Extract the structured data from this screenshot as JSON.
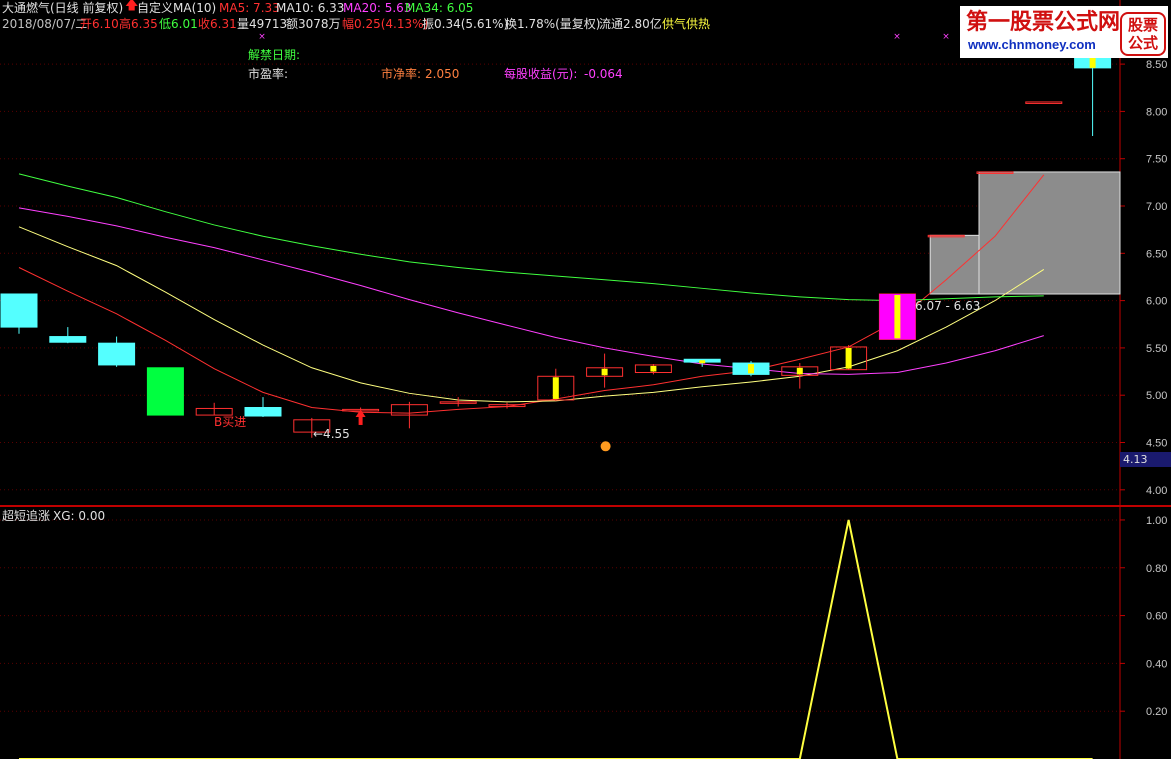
{
  "header": {
    "stock_name": "大通燃气",
    "period": "(日线 前复权)",
    "indicator_name": "自定义MA(10)",
    "ma5": "MA5: 7.33",
    "ma10": "MA10: 6.33",
    "ma20": "MA20: 5.63",
    "ma34": "MA34: 6.05",
    "date": "2018/08/07/二",
    "open_label": "开",
    "open": "6.10",
    "high_label": "高",
    "high": "6.35",
    "low_label": "低",
    "low": "6.01",
    "close_label": "收",
    "close": "6.31",
    "volume": "量49713",
    "amount": "额3078万",
    "change_label": "幅",
    "change": "0.25(4.13%)",
    "amplitude": "振0.34(5.61%)",
    "turnover": "换1.78%(量复权)",
    "float": "流通2.80亿",
    "concept": "供气供热"
  },
  "info": {
    "unlock_date": "解禁日期:",
    "pe": "市盈率:",
    "pb_label": "市净率:",
    "pb": "2.050",
    "eps_label": "每股收益(元):",
    "eps": "-0.064"
  },
  "annotations": {
    "buy_signal": "B买进",
    "low_marker": "←4.55",
    "range_label": "6.07 - 6.63",
    "current_price": "4.13"
  },
  "watermark": {
    "title": "第一股票公式网",
    "url": "www.chnmoney.com",
    "badge_top": "股票",
    "badge_bottom": "公式"
  },
  "sub_panel": {
    "name": "超短追涨",
    "xg": "XG: 0.00"
  },
  "colors": {
    "up": "#ff3030",
    "down_cyan": "#54ffff",
    "down_green": "#00ff40",
    "ma5": "#ff3030",
    "ma10": "#ffff80",
    "ma20": "#ff40ff",
    "ma34": "#40ff40",
    "axis": "#c00000",
    "grid": "#5a0000",
    "gray_box": "#8c8c8c"
  },
  "chart_data": [
    {
      "type": "candlestick",
      "title": "大通燃气(日线 前复权)",
      "ylim": [
        3.85,
        8.85
      ],
      "yticks": [
        "4.00",
        "4.50",
        "5.00",
        "5.50",
        "6.00",
        "6.50",
        "7.00",
        "7.50",
        "8.00",
        "8.50"
      ],
      "candles": [
        {
          "open": 6.07,
          "high": 6.07,
          "low": 5.65,
          "close": 5.72
        },
        {
          "open": 5.62,
          "high": 5.72,
          "low": 5.55,
          "close": 5.56
        },
        {
          "open": 5.55,
          "high": 5.62,
          "low": 5.3,
          "close": 5.32
        },
        {
          "open": 5.29,
          "high": 5.29,
          "low": 4.79,
          "close": 4.79
        },
        {
          "open": 4.79,
          "high": 4.92,
          "low": 4.79,
          "close": 4.86
        },
        {
          "open": 4.87,
          "high": 4.98,
          "low": 4.77,
          "close": 4.78
        },
        {
          "open": 4.61,
          "high": 4.76,
          "low": 4.55,
          "close": 4.74
        },
        {
          "open": 4.85,
          "high": 4.87,
          "low": 4.81,
          "close": 4.85
        },
        {
          "open": 4.79,
          "high": 4.93,
          "low": 4.65,
          "close": 4.9
        },
        {
          "open": 4.93,
          "high": 4.98,
          "low": 4.88,
          "close": 4.93
        },
        {
          "open": 4.88,
          "high": 4.92,
          "low": 4.86,
          "close": 4.9
        },
        {
          "open": 4.95,
          "high": 5.28,
          "low": 4.94,
          "close": 5.2
        },
        {
          "open": 5.2,
          "high": 5.44,
          "low": 5.08,
          "close": 5.29
        },
        {
          "open": 5.24,
          "high": 5.33,
          "low": 5.22,
          "close": 5.32
        },
        {
          "open": 5.38,
          "high": 5.38,
          "low": 5.3,
          "close": 5.35
        },
        {
          "open": 5.34,
          "high": 5.36,
          "low": 5.2,
          "close": 5.22
        },
        {
          "open": 5.21,
          "high": 5.34,
          "low": 5.07,
          "close": 5.3
        },
        {
          "open": 5.27,
          "high": 5.53,
          "low": 5.27,
          "close": 5.51
        },
        {
          "open": 5.59,
          "high": 6.07,
          "low": 5.59,
          "close": 6.07
        },
        {
          "open": 6.69,
          "high": 6.69,
          "low": 6.69,
          "close": 6.69
        },
        {
          "open": 7.36,
          "high": 7.36,
          "low": 7.36,
          "close": 7.36
        },
        {
          "open": 8.1,
          "high": 8.1,
          "low": 8.1,
          "close": 8.1
        },
        {
          "open": 8.57,
          "high": 8.64,
          "low": 7.74,
          "close": 8.46
        }
      ],
      "series": [
        {
          "name": "MA5",
          "values": [
            6.35,
            6.1,
            5.86,
            5.58,
            5.28,
            5.03,
            4.87,
            4.82,
            4.81,
            4.85,
            4.88,
            4.96,
            5.05,
            5.11,
            5.2,
            5.26,
            5.38,
            5.51,
            5.79,
            6.22,
            6.68,
            7.33
          ]
        },
        {
          "name": "MA10",
          "values": [
            6.78,
            6.57,
            6.37,
            6.09,
            5.8,
            5.53,
            5.29,
            5.13,
            5.02,
            4.95,
            4.93,
            4.94,
            4.99,
            5.03,
            5.09,
            5.14,
            5.2,
            5.3,
            5.47,
            5.72,
            6.0,
            6.33
          ]
        },
        {
          "name": "MA20",
          "values": [
            6.98,
            6.89,
            6.79,
            6.67,
            6.56,
            6.43,
            6.3,
            6.16,
            6.01,
            5.87,
            5.74,
            5.61,
            5.5,
            5.41,
            5.33,
            5.28,
            5.23,
            5.22,
            5.24,
            5.34,
            5.47,
            5.63
          ]
        },
        {
          "name": "MA34",
          "values": [
            7.34,
            7.21,
            7.09,
            6.94,
            6.8,
            6.68,
            6.58,
            6.49,
            6.41,
            6.35,
            6.3,
            6.26,
            6.22,
            6.18,
            6.13,
            6.08,
            6.04,
            6.01,
            6.0,
            6.02,
            6.04,
            6.05
          ]
        }
      ]
    },
    {
      "type": "line",
      "title": "超短追涨",
      "ylim": [
        0.0,
        1.05
      ],
      "yticks": [
        "0.20",
        "0.40",
        "0.60",
        "0.80",
        "1.00"
      ],
      "series": [
        {
          "name": "XG",
          "values": [
            0,
            0,
            0,
            0,
            0,
            0,
            0,
            0,
            0,
            0,
            0,
            0,
            0,
            0,
            0,
            0,
            0,
            1,
            0,
            0,
            0,
            0,
            0
          ]
        }
      ]
    }
  ]
}
